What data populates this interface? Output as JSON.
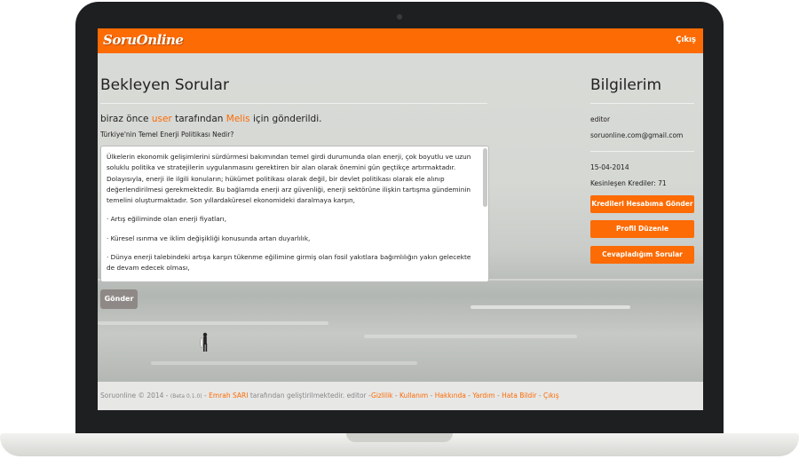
{
  "brand": {
    "logo": "SoruOnline",
    "accent": "#fc6b04"
  },
  "nav": {
    "logout": "Çıkış"
  },
  "left": {
    "heading": "Bekleyen Sorular",
    "sender_prefix": "biraz önce",
    "sender_user": "user",
    "sender_mid": "tarafından",
    "sender_target": "Melis",
    "sender_suffix": "için gönderildi.",
    "question_title": "Türkiye'nin Temel Enerji Politikası Nedir?",
    "answer_paragraphs": [
      "Ülkelerin ekonomik gelişimlerini sürdürmesi bakımından temel girdi durumunda olan enerji, çok boyutlu ve uzun soluklu politika ve stratejilerin uygulanmasını gerektiren bir alan olarak önemini gün geçtikçe artırmaktadır. Dolayısıyla, enerji ile ilgili konuların; hükümet politikası olarak değil, bir devlet politikası olarak ele alınıp değerlendirilmesi gerekmektedir. Bu bağlamda enerji arz güvenliği, enerji sektörüne ilişkin tartışma gündeminin temelini oluşturmaktadır. Son yıllardaküresel ekonomideki daralmaya karşın,",
      "·     Artış eğiliminde olan enerji fiyatları,",
      "·     Küresel ısınma ve iklim değişikliği konusunda artan duyarlılık,",
      "·     Dünya enerji talebindeki artışa karşın tükenme eğilimine girmiş olan fosil yakıtlara bağımlılığın yakın gelecekte de devam edecek olması,"
    ],
    "send_button": "Gönder"
  },
  "right": {
    "heading": "Bilgilerim",
    "username": "editor",
    "email": "soruonline.com@gmail.com",
    "date": "15-04-2014",
    "credits": "Kesinleşen Krediler: 71",
    "buttons": [
      "Kredileri Hesabıma Gönder",
      "Profil Düzenle",
      "Cevapladığım Sorular"
    ]
  },
  "footer": {
    "copyright": "Soruonline © 2014 -",
    "beta": "(Beta 0.1.0)",
    "dash": "-",
    "author": "Emrah SARI",
    "developed": "tarafından geliştirilmektedir. editor -",
    "links": [
      "Gizlilik",
      "Kullanım",
      "Hakkında",
      "Yardım",
      "Hata Bildir",
      "Çıkış"
    ],
    "sep": " - "
  }
}
